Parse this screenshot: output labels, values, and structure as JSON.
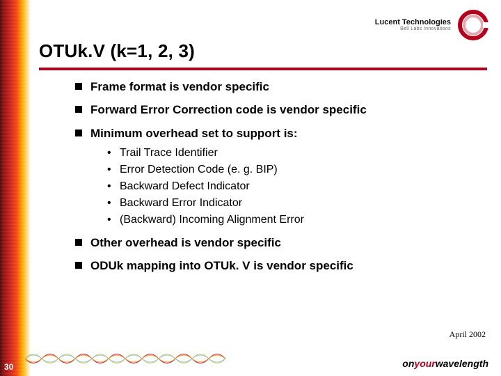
{
  "brand": {
    "name": "Lucent Technologies",
    "tagline": "Bell Labs Innovations"
  },
  "title": "OTUk.V (k=1, 2, 3)",
  "bullets": {
    "b1": "Frame format is vendor specific",
    "b2": "Forward Error Correction code is vendor specific",
    "b3": "Minimum overhead set to support is:",
    "b3_sub": {
      "s1": "Trail Trace Identifier",
      "s2": "Error Detection Code (e. g. BIP)",
      "s3": "Backward Defect Indicator",
      "s4": "Backward Error Indicator",
      "s5": "(Backward) Incoming Alignment Error"
    },
    "b4": "Other overhead is vendor specific",
    "b5": "ODUk mapping into OTUk. V is vendor specific"
  },
  "footer": {
    "date": "April 2002",
    "page": "30",
    "tag_pre": "on",
    "tag_accent": "your",
    "tag_post": "wavelength"
  }
}
